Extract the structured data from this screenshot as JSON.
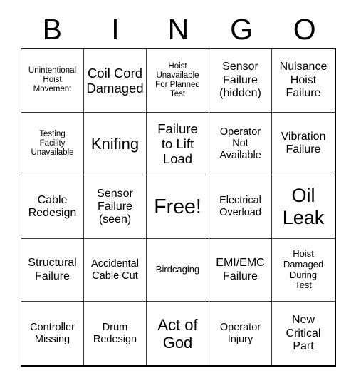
{
  "card": {
    "header_letters": [
      "B",
      "I",
      "N",
      "G",
      "O"
    ],
    "columns": 5,
    "rows": 5,
    "free_space_index": 12,
    "colors": {
      "text": "#000000",
      "grid_line": "#3a3a3a",
      "border": "#000000",
      "background": "#ffffff"
    },
    "cells": [
      {
        "text": "Unintentional\nHoist\nMovement",
        "size": "xxs"
      },
      {
        "text": "Coil Cord\nDamaged",
        "size": "l"
      },
      {
        "text": "Hoist\nUnavailable\nFor Planned\nTest",
        "size": "xxs"
      },
      {
        "text": "Sensor\nFailure\n(hidden)",
        "size": "m"
      },
      {
        "text": "Nuisance\nHoist\nFailure",
        "size": "m"
      },
      {
        "text": "Testing\nFacility\nUnavailable",
        "size": "xxs"
      },
      {
        "text": "Knifing",
        "size": "xl"
      },
      {
        "text": "Failure\nto Lift\nLoad",
        "size": "l"
      },
      {
        "text": "Operator\nNot\nAvailable",
        "size": "s"
      },
      {
        "text": "Vibration\nFailure",
        "size": "m"
      },
      {
        "text": "Cable\nRedesign",
        "size": "m"
      },
      {
        "text": "Sensor\nFailure\n(seen)",
        "size": "m"
      },
      {
        "text": "Free!",
        "size": "free"
      },
      {
        "text": "Electrical\nOverload",
        "size": "s"
      },
      {
        "text": "Oil\nLeak",
        "size": "xxl"
      },
      {
        "text": "Structural\nFailure",
        "size": "m"
      },
      {
        "text": "Accidental\nCable Cut",
        "size": "s"
      },
      {
        "text": "Birdcaging",
        "size": "xs"
      },
      {
        "text": "EMI/EMC\nFailure",
        "size": "m"
      },
      {
        "text": "Hoist\nDamaged\nDuring\nTest",
        "size": "xs"
      },
      {
        "text": "Controller\nMissing",
        "size": "s"
      },
      {
        "text": "Drum\nRedesign",
        "size": "s"
      },
      {
        "text": "Act of\nGod",
        "size": "xl"
      },
      {
        "text": "Operator\nInjury",
        "size": "s"
      },
      {
        "text": "New\nCritical\nPart",
        "size": "m"
      }
    ]
  }
}
